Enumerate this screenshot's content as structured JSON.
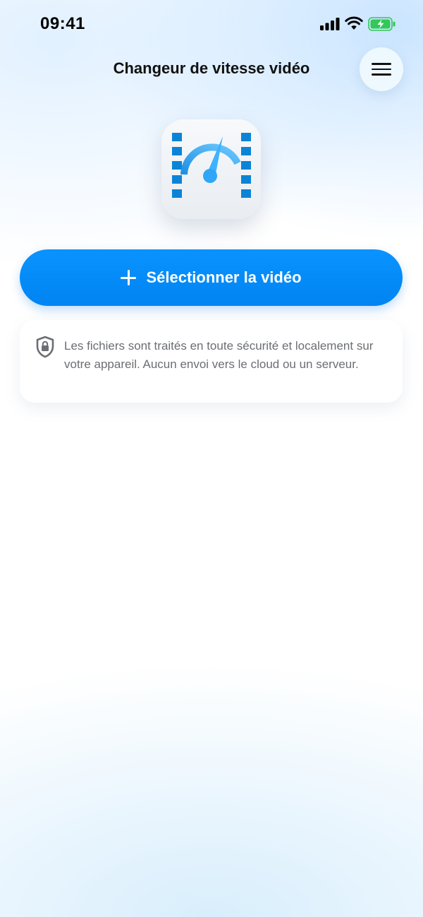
{
  "status_bar": {
    "time": "09:41"
  },
  "header": {
    "title": "Changeur de vitesse vidéo"
  },
  "main": {
    "select_button_label": "Sélectionner la vidéo",
    "info_text": "Les fichiers sont traités en toute sécurité et localement sur votre appareil. Aucun envoi vers le cloud ou un serveur."
  },
  "colors": {
    "accent": "#0A8CFF",
    "icon_blue": "#0B84D6",
    "battery_green": "#34C759"
  },
  "icons": {
    "menu": "hamburger-menu-icon",
    "add": "plus-icon",
    "security": "shield-lock-icon",
    "app": "video-speedometer-icon"
  }
}
